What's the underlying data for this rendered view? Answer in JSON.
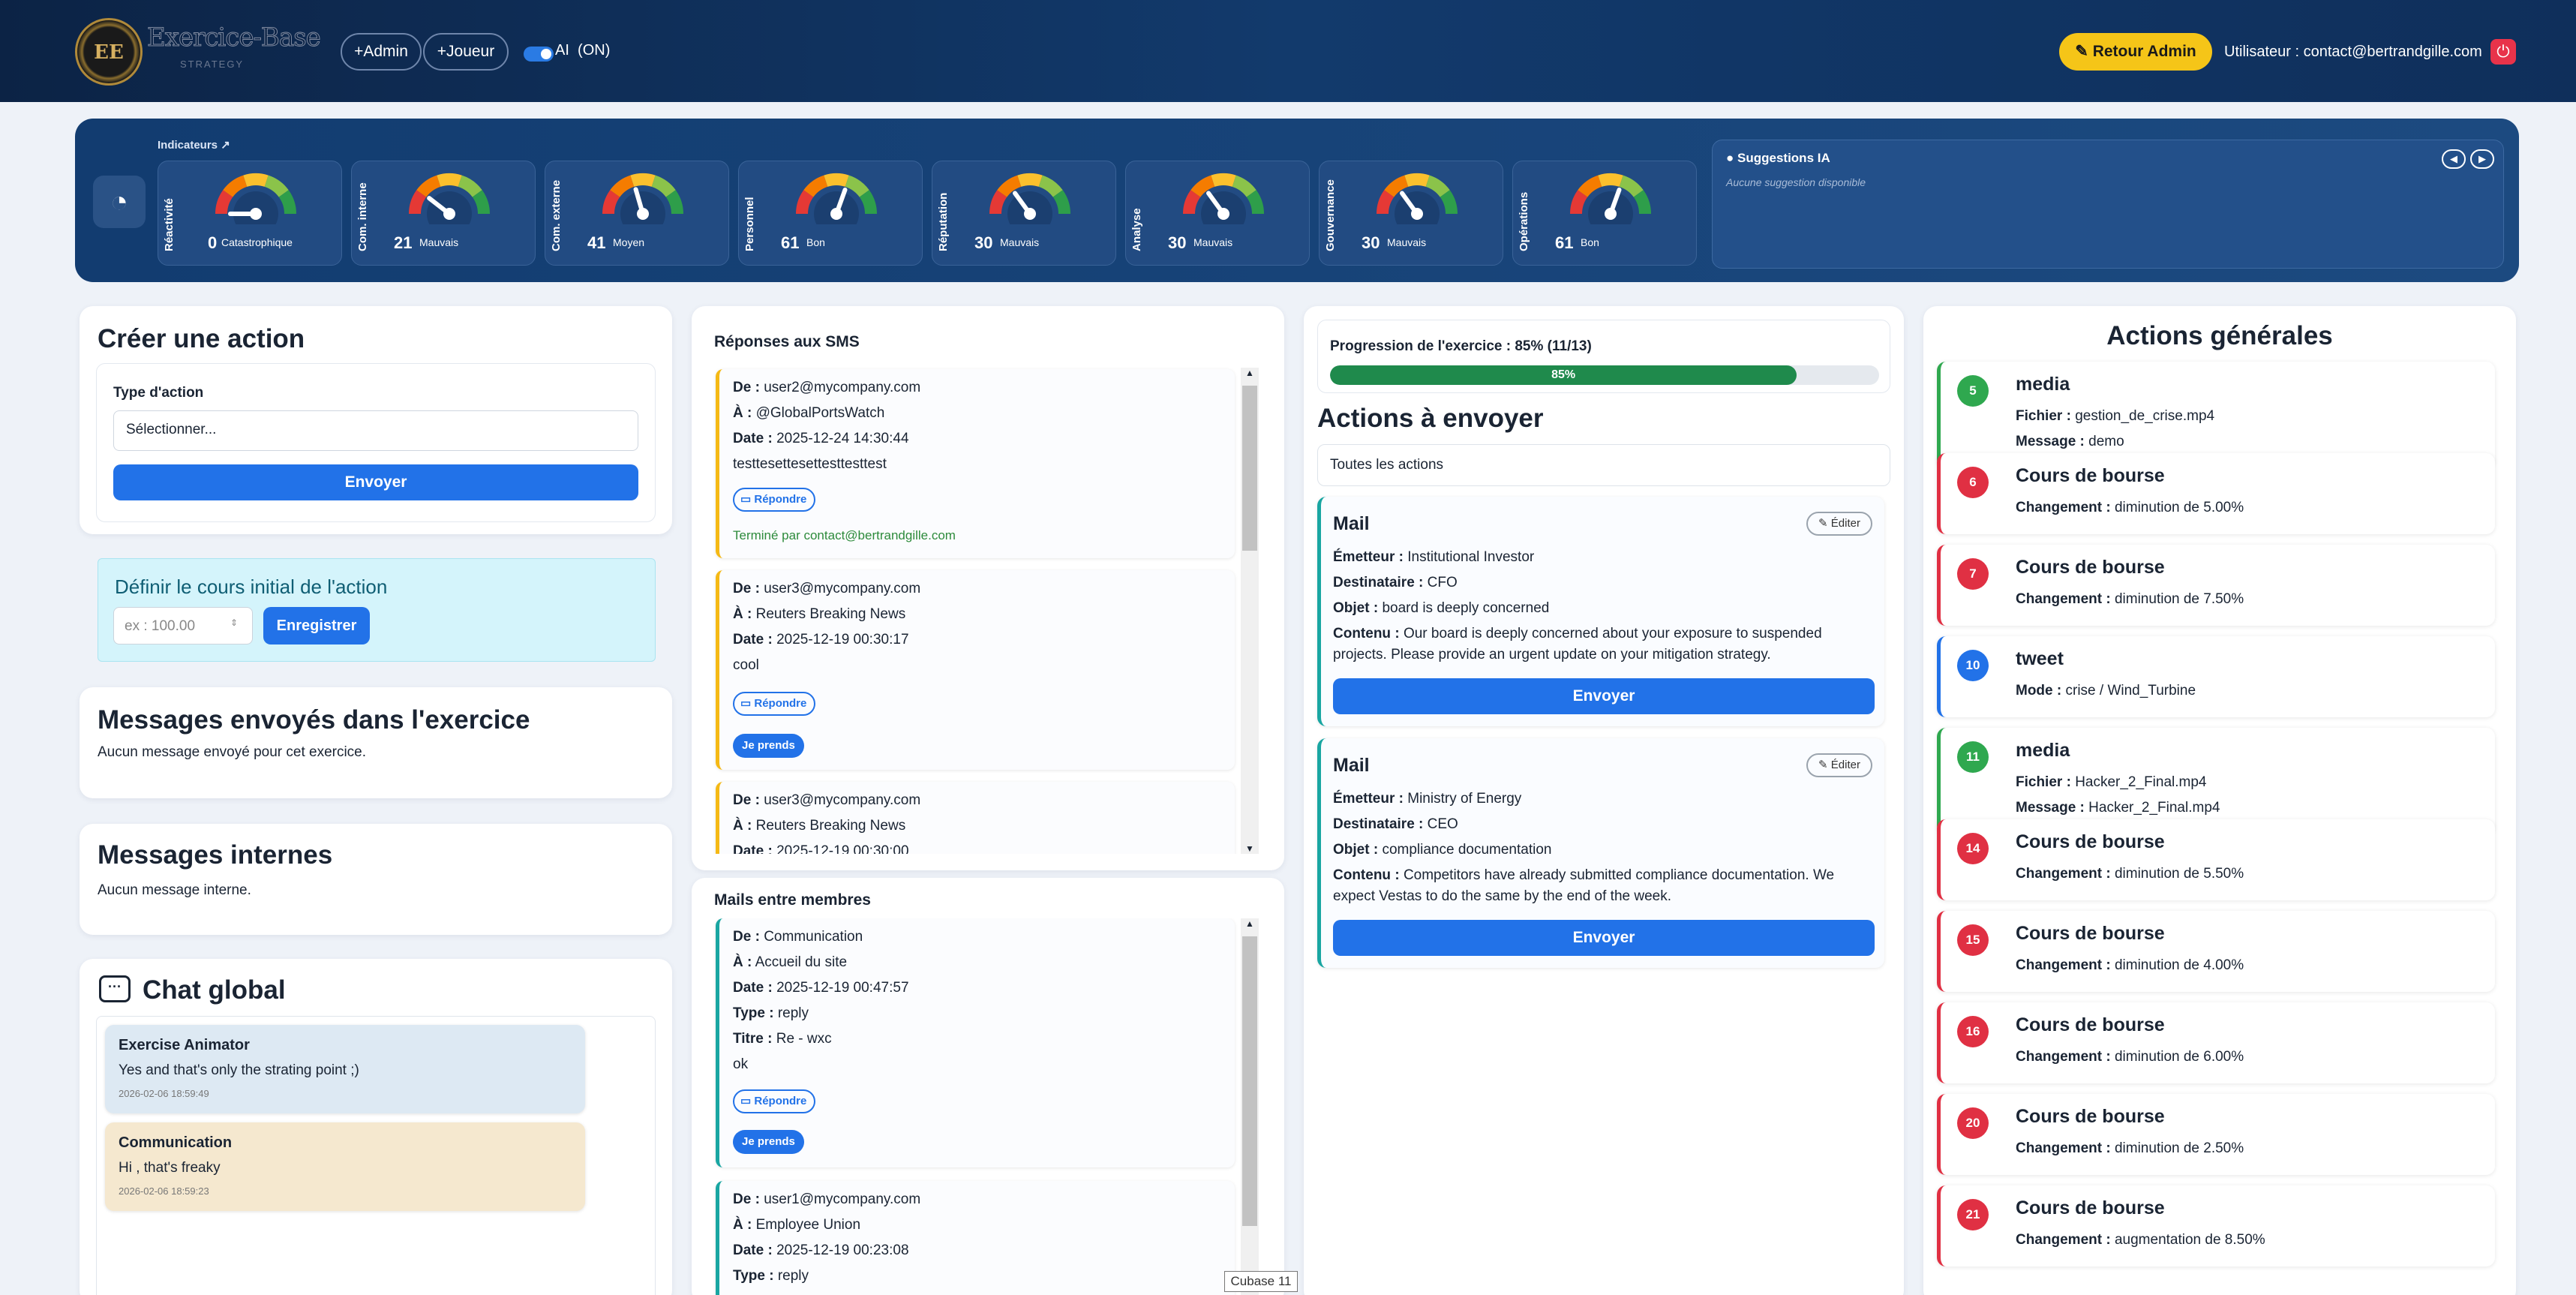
{
  "header": {
    "logo_mark": "EE",
    "logo_text": "Exercice-Base",
    "logo_sub": "STRATEGY",
    "btn_admin": "+Admin",
    "btn_joueur": "+Joueur",
    "ai_label": "AI",
    "ai_state": "(ON)",
    "retour_admin": "Retour Admin",
    "user": "Utilisateur : contact@bertrandgille.com"
  },
  "indicators": {
    "title": "Indicateurs",
    "items": [
      {
        "label": "Réactivité",
        "value": "0",
        "status": "Catastrophique",
        "level": 0
      },
      {
        "label": "Com. interne",
        "value": "21",
        "status": "Mauvais",
        "level": 21
      },
      {
        "label": "Com. externe",
        "value": "41",
        "status": "Moyen",
        "level": 41
      },
      {
        "label": "Personnel",
        "value": "61",
        "status": "Bon",
        "level": 61
      },
      {
        "label": "Réputation",
        "value": "30",
        "status": "Mauvais",
        "level": 30
      },
      {
        "label": "Analyse",
        "value": "30",
        "status": "Mauvais",
        "level": 30
      },
      {
        "label": "Gouvernance",
        "value": "30",
        "status": "Mauvais",
        "level": 30
      },
      {
        "label": "Opérations",
        "value": "61",
        "status": "Bon",
        "level": 61
      }
    ],
    "suggestions_title": "Suggestions IA",
    "suggestions_empty": "Aucune suggestion disponible"
  },
  "create": {
    "title": "Créer une action",
    "type_label": "Type d'action",
    "select_value": "Sélectionner...",
    "send": "Envoyer"
  },
  "cours": {
    "title": "Définir le cours initial de l'action",
    "placeholder": "ex : 100.00",
    "save": "Enregistrer"
  },
  "sent": {
    "title": "Messages envoyés dans l'exercice",
    "empty": "Aucun message envoyé pour cet exercice."
  },
  "internal": {
    "title": "Messages internes",
    "empty": "Aucun message interne."
  },
  "chat": {
    "title": "Chat global",
    "messages": [
      {
        "author": "Exercise Animator",
        "text": "Yes and that's only the strating point ;)",
        "date": "2026-02-06 18:59:49"
      },
      {
        "author": "Communication",
        "text": "Hi , that's freaky",
        "date": "2026-02-06 18:59:23"
      }
    ]
  },
  "labels": {
    "de": "De :",
    "a": "À :",
    "date": "Date :",
    "type": "Type :",
    "titre": "Titre :",
    "repondre": "Répondre",
    "je_prends": "Je prends",
    "emetteur": "Émetteur :",
    "destinataire": "Destinataire :",
    "objet": "Objet :",
    "contenu": "Contenu :",
    "editer": "Éditer",
    "fichier": "Fichier :",
    "message": "Message :",
    "changement": "Changement :",
    "mode": "Mode :"
  },
  "sms": {
    "title": "Réponses aux SMS",
    "items": [
      {
        "de": "user2@mycompany.com",
        "a": "@GlobalPortsWatch",
        "date": "2025-12-24 14:30:44",
        "body": "testtesettesettesttesttest",
        "done": "Terminé par contact@bertrandgille.com"
      },
      {
        "de": "user3@mycompany.com",
        "a": "Reuters Breaking News",
        "date": "2025-12-19 00:30:17",
        "body": "cool"
      },
      {
        "de": "user3@mycompany.com",
        "a": "Reuters Breaking News",
        "date": "2025-12-19 00:30:00"
      }
    ]
  },
  "mails": {
    "title": "Mails entre membres",
    "items": [
      {
        "de": "Communication",
        "a": "Accueil du site",
        "date": "2025-12-19 00:47:57",
        "type": "reply",
        "titre": "Re - wxc",
        "body": "ok"
      },
      {
        "de": "user1@mycompany.com",
        "a": "Employee Union",
        "date": "2025-12-19 00:23:08",
        "type": "reply"
      }
    ]
  },
  "tooltip": "Cubase 11",
  "progress": {
    "label": "Progression de l'exercice : 85% (11/13)",
    "pct_label": "85%",
    "value": 0.85
  },
  "to_send": {
    "title": "Actions à envoyer",
    "filter": "Toutes les actions",
    "items": [
      {
        "kind": "Mail",
        "emetteur": "Institutional Investor",
        "destinataire": "CFO",
        "objet": "board is deeply concerned",
        "contenu1": "Our board is deeply concerned about your exposure to suspended",
        "contenu2": "projects. Please provide an urgent update on your mitigation strategy."
      },
      {
        "kind": "Mail",
        "emetteur": "Ministry of Energy",
        "destinataire": "CEO",
        "objet": "compliance documentation",
        "contenu1": "Competitors have already submitted compliance documentation. We",
        "contenu2": "expect Vestas to do the same by the end of the week."
      }
    ]
  },
  "general": {
    "title": "Actions générales",
    "colors": {
      "media": "#2fa84f",
      "bourse": "#e03043",
      "tweet": "#2272e8"
    },
    "items": [
      {
        "num": "5",
        "title": "media",
        "l1k": "Fichier :",
        "l1v": "gestion_de_crise.mp4",
        "l2k": "Message :",
        "l2v": "demo",
        "kind": "media"
      },
      {
        "num": "6",
        "title": "Cours de bourse",
        "l1k": "Changement :",
        "l1v": "diminution de 5.00%",
        "kind": "bourse"
      },
      {
        "num": "7",
        "title": "Cours de bourse",
        "l1k": "Changement :",
        "l1v": "diminution de 7.50%",
        "kind": "bourse"
      },
      {
        "num": "10",
        "title": "tweet",
        "l1k": "Mode :",
        "l1v": "crise / Wind_Turbine",
        "kind": "tweet"
      },
      {
        "num": "11",
        "title": "media",
        "l1k": "Fichier :",
        "l1v": "Hacker_2_Final.mp4",
        "l2k": "Message :",
        "l2v": "Hacker_2_Final.mp4",
        "kind": "media"
      },
      {
        "num": "14",
        "title": "Cours de bourse",
        "l1k": "Changement :",
        "l1v": "diminution de 5.50%",
        "kind": "bourse"
      },
      {
        "num": "15",
        "title": "Cours de bourse",
        "l1k": "Changement :",
        "l1v": "diminution de 4.00%",
        "kind": "bourse"
      },
      {
        "num": "16",
        "title": "Cours de bourse",
        "l1k": "Changement :",
        "l1v": "diminution de 6.00%",
        "kind": "bourse"
      },
      {
        "num": "20",
        "title": "Cours de bourse",
        "l1k": "Changement :",
        "l1v": "diminution de 2.50%",
        "kind": "bourse"
      },
      {
        "num": "21",
        "title": "Cours de bourse",
        "l1k": "Changement :",
        "l1v": "augmentation de 8.50%",
        "kind": "bourse"
      }
    ]
  }
}
